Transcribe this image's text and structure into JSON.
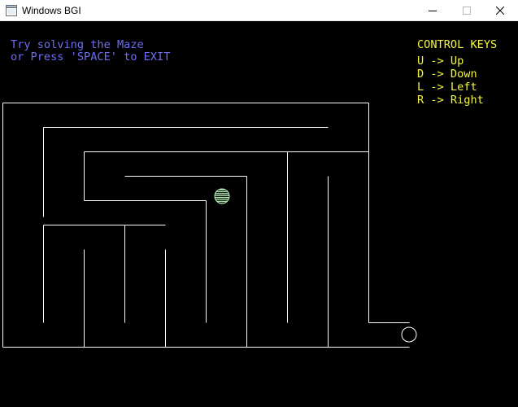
{
  "window": {
    "title": "Windows BGI",
    "icon": "bgi-window-icon",
    "controls": [
      "minimize-icon",
      "maximize-icon",
      "close-icon"
    ]
  },
  "message": {
    "line1": "Try solving the Maze",
    "line2": "or Press 'SPACE' to EXIT",
    "color": "#6e6ef2"
  },
  "control_keys": {
    "heading": "CONTROL KEYS",
    "keys": [
      {
        "text": "U -> Up"
      },
      {
        "text": "D -> Down"
      },
      {
        "text": "L -> Left"
      },
      {
        "text": "R -> Right"
      }
    ],
    "color": "#f5f542"
  },
  "maze": {
    "wall_color": "#ffffff",
    "player": {
      "icon": "hatched-ball-icon",
      "color": "#b8f0b8"
    },
    "goal": {
      "icon": "circle-goal-icon",
      "color": "#ffffff"
    }
  }
}
